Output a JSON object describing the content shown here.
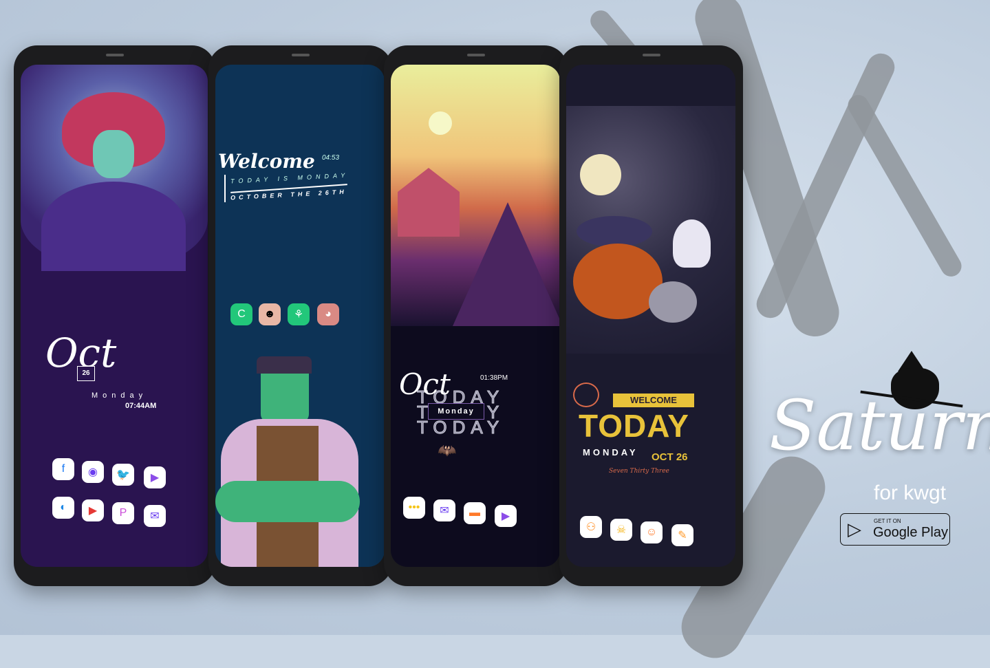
{
  "phone1": {
    "month": "Oct",
    "day": "26",
    "weekday": "Monday",
    "time": "07:44AM",
    "icons": [
      "facebook-icon",
      "camera-icon",
      "twitter-icon",
      "play-store-icon",
      "browser-icon",
      "youtube-icon",
      "pinterest-icon",
      "mail-icon"
    ]
  },
  "phone2": {
    "greeting": "Welcome",
    "time": "04:53",
    "line1": "TODAY IS MONDAY",
    "line2": "OCTOBER THE 26TH",
    "icons": [
      "phone-icon",
      "face-icon",
      "tulip-icon",
      "globe-icon"
    ]
  },
  "phone3": {
    "month": "Oct",
    "time": "01:38PM",
    "today": "TODAY",
    "weekday": "Monday",
    "icons": [
      "messages-icon",
      "mail-icon",
      "folder-icon",
      "play-store-icon"
    ]
  },
  "phone4": {
    "welcome": "WELCOME",
    "today": "TODAY",
    "weekday": "MONDAY",
    "date": "OCT 26",
    "time_words": "Seven Thirty Three",
    "icons": [
      "game-icon",
      "skull-icon",
      "smile-icon",
      "notes-icon"
    ]
  },
  "brand": {
    "name": "Saturn",
    "subtitle": "for kwgt",
    "store_small": "GET IT ON",
    "store_big": "Google Play"
  }
}
